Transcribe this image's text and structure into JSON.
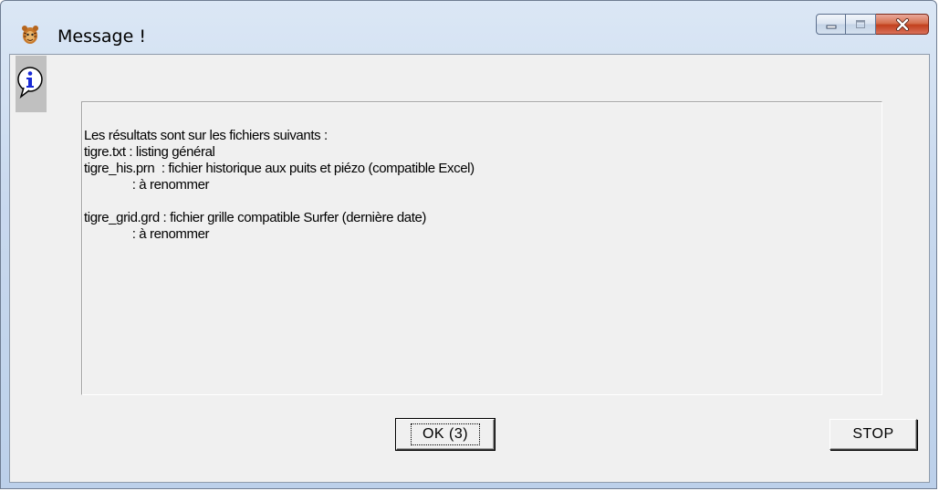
{
  "window": {
    "title": "Message !",
    "minimize_icon": "minimize-icon",
    "maximize_icon": "maximize-icon",
    "close_icon": "close-icon",
    "app_icon": "tiger-app-icon"
  },
  "dialog": {
    "icon": "info-icon",
    "message": "Les résultats sont sur les fichiers suivants :\ntigre.txt : listing général\ntigre_his.prn  : fichier historique aux puits et piézo (compatible Excel)\n              : à renommer\n\ntigre_grid.grd : fichier grille compatible Surfer (dernière date)\n              : à renommer"
  },
  "buttons": {
    "ok_label": "OK (3)",
    "stop_label": "STOP"
  }
}
